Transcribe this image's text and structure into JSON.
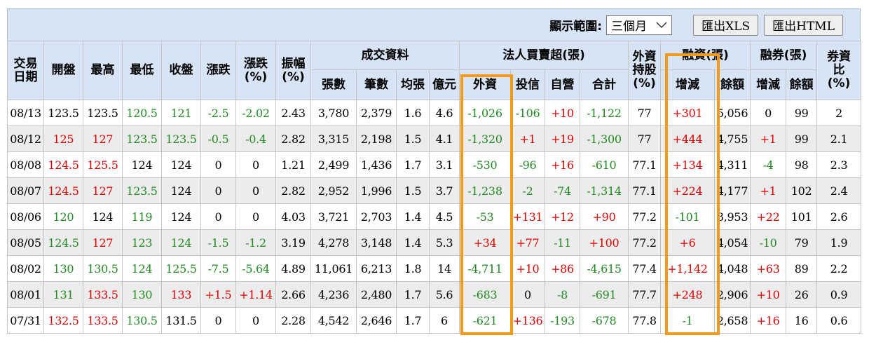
{
  "toolbar": {
    "range_label": "顯示範圍:",
    "range_value": "三個月",
    "export_xls": "匯出XLS",
    "export_html": "匯出HTML"
  },
  "headers": {
    "date": "交易日期",
    "open": "開盤",
    "high": "最高",
    "low": "最低",
    "close": "收盤",
    "change": "漲跌",
    "change_pct": "漲跌(%)",
    "amplitude": "振幅(%)",
    "volume_group": "成交資料",
    "volume_cols": [
      "張數",
      "筆數",
      "均張",
      "億元"
    ],
    "inst_group": "法人買賣超(張)",
    "inst_cols": [
      "外資",
      "投信",
      "自營",
      "合計"
    ],
    "foreign_hold": "外資持股(%)",
    "margin_group": "融資(張)",
    "margin_cols": [
      "增減",
      "餘額"
    ],
    "short_group": "融券(張)",
    "short_cols": [
      "增減",
      "餘額"
    ],
    "ratio": "券資比(%)"
  },
  "rows": [
    [
      "08/13",
      "123.5",
      "123.5",
      "120.5",
      "121",
      "-2.5",
      "-2.02",
      "2.43",
      "3,780",
      "2,379",
      "1.6",
      "4.6",
      "-1,026",
      "-106",
      "+10",
      "-1,122",
      "77",
      "+301",
      "5,056",
      "0",
      "99",
      "2"
    ],
    [
      "08/12",
      "125",
      "127",
      "123.5",
      "123.5",
      "-0.5",
      "-0.4",
      "2.82",
      "3,315",
      "2,198",
      "1.5",
      "4.1",
      "-1,320",
      "+1",
      "+19",
      "-1,300",
      "77",
      "+444",
      "4,755",
      "+1",
      "99",
      "2.1"
    ],
    [
      "08/08",
      "124.5",
      "125.5",
      "124",
      "124",
      "0",
      "0",
      "1.21",
      "2,499",
      "1,436",
      "1.7",
      "3.1",
      "-530",
      "-96",
      "+16",
      "-610",
      "77.1",
      "+134",
      "4,311",
      "-4",
      "98",
      "2.3"
    ],
    [
      "08/07",
      "124.5",
      "127",
      "123.5",
      "124",
      "0",
      "0",
      "2.82",
      "2,952",
      "1,996",
      "1.5",
      "3.7",
      "-1,238",
      "-2",
      "-74",
      "-1,314",
      "77.1",
      "+224",
      "4,177",
      "+1",
      "102",
      "2.4"
    ],
    [
      "08/06",
      "120",
      "124",
      "119",
      "124",
      "0",
      "0",
      "4.03",
      "3,721",
      "2,703",
      "1.4",
      "4.5",
      "-53",
      "+131",
      "+12",
      "+90",
      "77.2",
      "-101",
      "3,953",
      "+22",
      "101",
      "2.6"
    ],
    [
      "08/05",
      "124.5",
      "127",
      "123",
      "124",
      "-1.5",
      "-1.2",
      "3.19",
      "4,278",
      "3,148",
      "1.4",
      "5.3",
      "+34",
      "+77",
      "-11",
      "+100",
      "77.2",
      "+6",
      "4,054",
      "-10",
      "79",
      "1.9"
    ],
    [
      "08/02",
      "130",
      "130.5",
      "124",
      "125.5",
      "-7.5",
      "-5.64",
      "4.89",
      "11,061",
      "6,213",
      "1.8",
      "14",
      "-4,711",
      "+10",
      "+86",
      "-4,615",
      "77.4",
      "+1,142",
      "4,048",
      "+63",
      "89",
      "2.2"
    ],
    [
      "08/01",
      "131",
      "133.5",
      "130",
      "133",
      "+1.5",
      "+1.14",
      "2.66",
      "4,236",
      "2,480",
      "1.7",
      "5.6",
      "-683",
      "0",
      "-8",
      "-691",
      "77.7",
      "+248",
      "2,906",
      "+10",
      "26",
      "0.9"
    ],
    [
      "07/31",
      "132.5",
      "133.5",
      "130.5",
      "131.5",
      "0",
      "0",
      "2.28",
      "4,542",
      "2,646",
      "1.7",
      "6",
      "-621",
      "+136",
      "-193",
      "-678",
      "77.8",
      "-1",
      "2,658",
      "+16",
      "16",
      "0.6"
    ]
  ],
  "row_colors": [
    [
      "k",
      "k",
      "k",
      "g",
      "g",
      "g",
      "g",
      "k",
      "k",
      "k",
      "k",
      "k",
      "g",
      "g",
      "r",
      "g",
      "k",
      "r",
      "k",
      "k",
      "k",
      "k"
    ],
    [
      "k",
      "r",
      "r",
      "g",
      "g",
      "g",
      "g",
      "k",
      "k",
      "k",
      "k",
      "k",
      "g",
      "r",
      "r",
      "g",
      "k",
      "r",
      "k",
      "r",
      "k",
      "k"
    ],
    [
      "k",
      "r",
      "r",
      "k",
      "k",
      "k",
      "k",
      "k",
      "k",
      "k",
      "k",
      "k",
      "g",
      "g",
      "r",
      "g",
      "k",
      "r",
      "k",
      "g",
      "k",
      "k"
    ],
    [
      "k",
      "r",
      "r",
      "g",
      "k",
      "k",
      "k",
      "k",
      "k",
      "k",
      "k",
      "k",
      "g",
      "g",
      "g",
      "g",
      "k",
      "r",
      "k",
      "r",
      "k",
      "k"
    ],
    [
      "k",
      "g",
      "k",
      "g",
      "k",
      "k",
      "k",
      "k",
      "k",
      "k",
      "k",
      "k",
      "g",
      "r",
      "r",
      "r",
      "k",
      "g",
      "k",
      "r",
      "k",
      "k"
    ],
    [
      "k",
      "g",
      "r",
      "g",
      "g",
      "g",
      "g",
      "k",
      "k",
      "k",
      "k",
      "k",
      "r",
      "r",
      "g",
      "r",
      "k",
      "r",
      "k",
      "g",
      "k",
      "k"
    ],
    [
      "k",
      "g",
      "g",
      "g",
      "g",
      "g",
      "g",
      "k",
      "k",
      "k",
      "k",
      "k",
      "g",
      "r",
      "r",
      "g",
      "k",
      "r",
      "k",
      "r",
      "k",
      "k"
    ],
    [
      "k",
      "g",
      "r",
      "g",
      "r",
      "r",
      "r",
      "k",
      "k",
      "k",
      "k",
      "k",
      "g",
      "k",
      "g",
      "g",
      "k",
      "r",
      "k",
      "r",
      "k",
      "k"
    ],
    [
      "k",
      "r",
      "r",
      "g",
      "k",
      "k",
      "k",
      "k",
      "k",
      "k",
      "k",
      "k",
      "g",
      "r",
      "g",
      "g",
      "k",
      "g",
      "k",
      "r",
      "k",
      "k"
    ]
  ],
  "colors": {
    "header_bg": "#d6e4f5",
    "stripe_bg": "#ececec",
    "up": "#e00000",
    "down": "#228b22",
    "highlight": "#f39a1a"
  }
}
